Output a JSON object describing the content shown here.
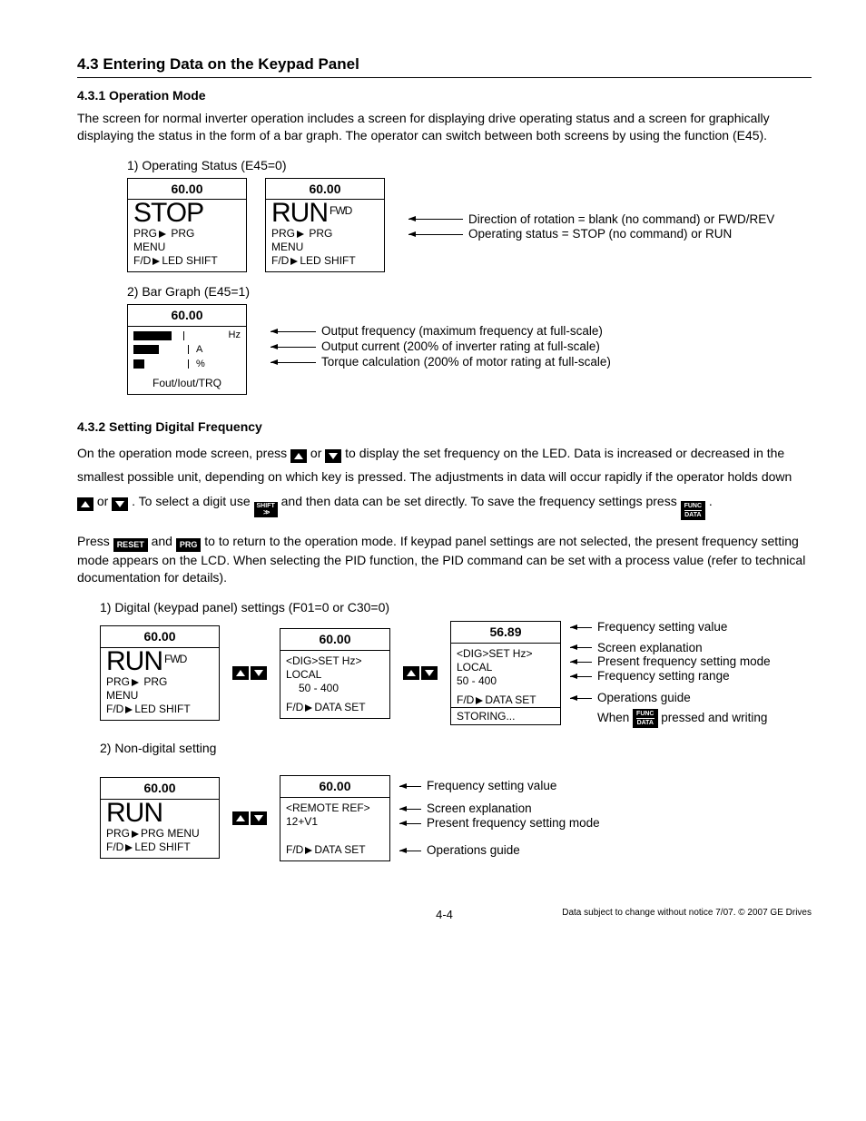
{
  "section_title": "4.3 Entering Data on the Keypad Panel",
  "s431": {
    "title": "4.3.1 Operation Mode",
    "para": "The screen for normal inverter operation includes a screen for displaying drive operating status  and a screen for graphically displaying the status in the form of a bar graph. The operator can switch between both screens by using the function (E45).",
    "cap1": "1) Operating Status (E45=0)",
    "cap2": "2) Bar Graph (E45=1)",
    "panel_a": {
      "top": "60.00",
      "big": "STOP",
      "l1a": "PRG",
      "l1b": "PRG",
      "l2": "MENU",
      "l3a": "F/D",
      "l3b": "LED SHIFT"
    },
    "panel_b": {
      "top": "60.00",
      "big": "RUN",
      "fwd": "FWD",
      "l1a": "PRG",
      "l1b": "PRG",
      "l2": "MENU",
      "l3a": "F/D",
      "l3b": "LED SHIFT"
    },
    "annot1": "Direction of rotation = blank (no command) or FWD/REV",
    "annot2": "Operating status = STOP (no command) or RUN",
    "bar_panel": {
      "top": "60.00",
      "u1": "Hz",
      "u2": "A",
      "u3": "%",
      "bottom": "Fout/Iout/TRQ"
    },
    "barnote1": "Output frequency (maximum frequency at full-scale)",
    "barnote2": "Output current (200% of inverter rating at full-scale)",
    "barnote3": "Torque calculation (200% of motor rating at full-scale)"
  },
  "s432": {
    "title": "4.3.2  Setting Digital Frequency",
    "p1_a": "On the operation mode screen, press ",
    "p1_b": " or ",
    "p1_c": " to display the set frequency on the LED.  Data is  increased or decreased in the smallest possible unit, depending on which key is pressed. The adjustments in data will occur rapidly if the operator holds down ",
    "p1_d": " or ",
    "p1_e": " . To select a digit use ",
    "p1_f": " and then data can be set directly. To save the frequency settings press ",
    "p1_g": " .",
    "p2_a": "Press ",
    "p2_b": " and ",
    "p2_c": " to to return to the operation mode. If keypad panel settings are not selected, the present frequency setting mode appears on the LCD. When selecting the PID function, the PID command can be set with a process value (refer to technical documentation for details).",
    "cap1": "1) Digital (keypad panel) settings (F01=0 or C30=0)",
    "cap2": "2) Non-digital setting",
    "row1_p1": {
      "top": "60.00",
      "big": "RUN",
      "fwd": "FWD",
      "l1a": "PRG",
      "l1b": "PRG",
      "l2": "MENU",
      "l3a": "F/D",
      "l3b": "LED SHIFT"
    },
    "row1_p2": {
      "top": "60.00",
      "l1": "<DIG>SET Hz>",
      "l2": "LOCAL",
      "l3": "50 - 400",
      "l4a": "F/D",
      "l4b": "DATA SET"
    },
    "row1_p3": {
      "top": "56.89",
      "l1": "<DIG>SET Hz>",
      "l2": "LOCAL",
      "l3": "50 - 400",
      "l4a": "F/D",
      "l4b": "DATA SET",
      "l5": "STORING..."
    },
    "row1_annot": {
      "a1": "Frequency setting value",
      "a2": "Screen explanation",
      "a3": "Present frequency setting mode",
      "a4": "Frequency setting range",
      "a5": "Operations guide",
      "a6a": "When ",
      "a6b": " pressed and writing"
    },
    "row2_p1": {
      "top": "60.00",
      "big": "RUN",
      "l1a": "PRG",
      "l1b": "PRG MENU",
      "l3a": "F/D",
      "l3b": "LED SHIFT"
    },
    "row2_p2": {
      "top": "60.00",
      "l1": "<REMOTE REF>",
      "l2": "12+V1",
      "l4a": "F/D",
      "l4b": "DATA SET"
    },
    "row2_annot": {
      "a1": "Frequency setting value",
      "a2": "Screen explanation",
      "a3": "Present frequency setting mode",
      "a4": "Operations guide"
    }
  },
  "keys": {
    "shift_top": "SHIFT",
    "func": "FUNC",
    "data": "DATA",
    "reset": "RESET",
    "prg": "PRG"
  },
  "footer": {
    "page": "4-4",
    "notice": "Data subject to change without notice 7/07. © 2007 GE Drives"
  }
}
